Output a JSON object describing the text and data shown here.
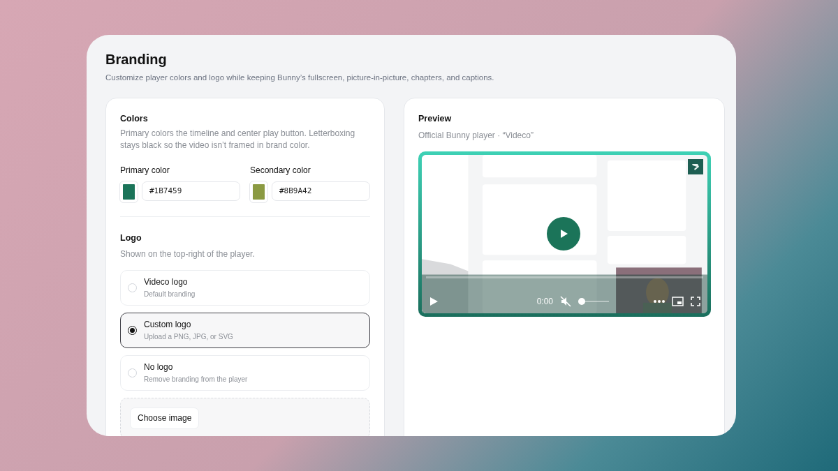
{
  "header": {
    "title": "Branding",
    "subtitle": "Customize player colors and logo while keeping Bunny’s fullscreen, picture-in-picture, chapters, and captions."
  },
  "colors": {
    "title": "Colors",
    "description": "Primary colors the timeline and center play button. Letterboxing stays black so the video isn’t framed in brand color.",
    "fields": [
      {
        "label": "Primary color",
        "value": "#1B7459",
        "color": "#1b7459"
      },
      {
        "label": "Secondary color",
        "value": "#8B9A42",
        "color": "#8b9a42"
      }
    ]
  },
  "logo": {
    "title": "Logo",
    "description": "Shown on the top-right of the player.",
    "options": [
      {
        "label": "Videco logo",
        "hint": "Default branding",
        "selected": false
      },
      {
        "label": "Custom logo",
        "hint": "Upload a PNG, JPG, or SVG",
        "selected": true
      },
      {
        "label": "No logo",
        "hint": "Remove branding from the player",
        "selected": false
      }
    ],
    "upload_button": "Choose image"
  },
  "preview": {
    "title": "Preview",
    "subtitle": "Official Bunny player · “Videco”",
    "player": {
      "time": "0:00",
      "muted": true,
      "progress": {
        "level": 0
      },
      "volume": {
        "level": 0
      }
    }
  }
}
